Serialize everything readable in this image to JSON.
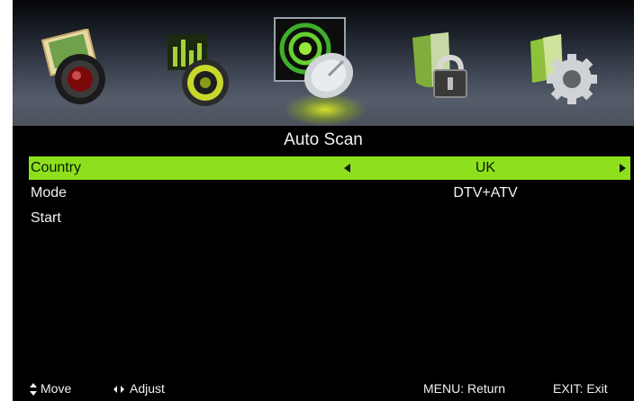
{
  "menu": {
    "title": "Auto Scan",
    "items": [
      {
        "label": "Country",
        "value": "UK"
      },
      {
        "label": "Mode",
        "value": "DTV+ATV"
      },
      {
        "label": "Start",
        "value": ""
      }
    ]
  },
  "tabs": [
    {
      "icon": "picture-icon"
    },
    {
      "icon": "sound-icon"
    },
    {
      "icon": "channel-satellite-icon"
    },
    {
      "icon": "lock-icon"
    },
    {
      "icon": "setup-gear-icon"
    }
  ],
  "footer": {
    "move": "Move",
    "adjust": "Adjust",
    "menu_return": "MENU: Return",
    "exit": "EXIT: Exit"
  },
  "colors": {
    "highlight": "#8ee01e",
    "background": "#000000"
  }
}
